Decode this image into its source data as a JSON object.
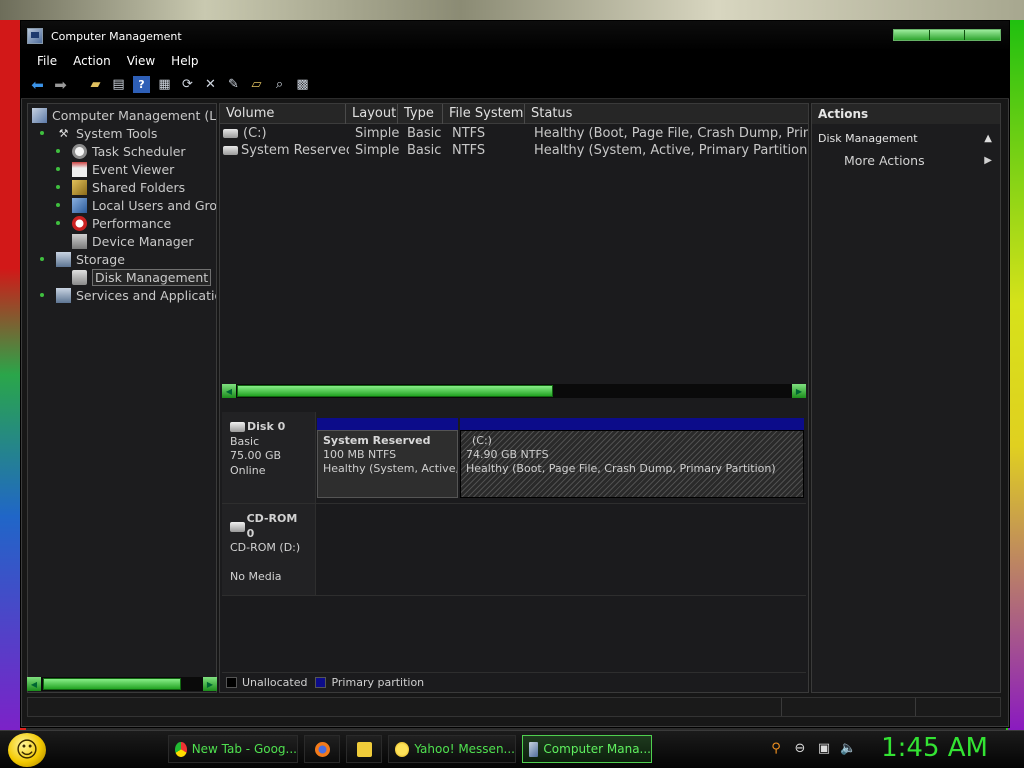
{
  "window": {
    "title": "Computer Management"
  },
  "menu": [
    "File",
    "Action",
    "View",
    "Help"
  ],
  "toolbar": {
    "icons": [
      "back-arrow-icon",
      "forward-arrow-icon",
      "folder-up-icon",
      "show-hide-tree-icon",
      "help-icon",
      "properties-icon",
      "refresh-icon",
      "delete-icon",
      "export-icon",
      "open-icon",
      "find-icon",
      "settings-icon"
    ]
  },
  "tree": {
    "items": [
      {
        "label": "Computer Management (Loc",
        "icon": "computer-icon",
        "level": 0
      },
      {
        "label": "System Tools",
        "icon": "tools-icon",
        "level": 1
      },
      {
        "label": "Task Scheduler",
        "icon": "clock-icon",
        "level": 2
      },
      {
        "label": "Event Viewer",
        "icon": "event-viewer-icon",
        "level": 2
      },
      {
        "label": "Shared Folders",
        "icon": "shared-folder-icon",
        "level": 2
      },
      {
        "label": "Local Users and Grou",
        "icon": "users-icon",
        "level": 2
      },
      {
        "label": "Performance",
        "icon": "performance-icon",
        "level": 2
      },
      {
        "label": "Device Manager",
        "icon": "device-manager-icon",
        "level": 2
      },
      {
        "label": "Storage",
        "icon": "storage-icon",
        "level": 1
      },
      {
        "label": "Disk Management",
        "icon": "disk-icon",
        "level": 2,
        "selected": true
      },
      {
        "label": "Services and Applications",
        "icon": "services-icon",
        "level": 1
      }
    ]
  },
  "volumes": {
    "columns": [
      "Volume",
      "Layout",
      "Type",
      "File System",
      "Status"
    ],
    "rows": [
      {
        "volume": "(C:)",
        "layout": "Simple",
        "type": "Basic",
        "fs": "NTFS",
        "status": "Healthy (Boot, Page File, Crash Dump, Primary"
      },
      {
        "volume": "System Reserved",
        "layout": "Simple",
        "type": "Basic",
        "fs": "NTFS",
        "status": "Healthy (System, Active, Primary Partition)"
      }
    ]
  },
  "disks": [
    {
      "name": "Disk 0",
      "kind": "Basic",
      "size": "75.00 GB",
      "state": "Online",
      "partitions": [
        {
          "name": "System Reserved",
          "size": "100 MB NTFS",
          "status": "Healthy (System, Active, P"
        },
        {
          "name": "(C:)",
          "size": "74.90 GB NTFS",
          "status": "Healthy (Boot, Page File, Crash Dump, Primary Partition)"
        }
      ]
    },
    {
      "name": "CD-ROM 0",
      "kind": "CD-ROM (D:)",
      "state": "No Media"
    }
  ],
  "legend": {
    "unallocated": "Unallocated",
    "primary": "Primary partition"
  },
  "actions": {
    "title": "Actions",
    "section": "Disk Management",
    "more": "More Actions"
  },
  "taskbar": {
    "items": [
      {
        "label": "New Tab - Goog...",
        "icon": "chrome-icon"
      },
      {
        "label": "",
        "icon": "firefox-icon"
      },
      {
        "label": "",
        "icon": "explorer-icon"
      },
      {
        "label": "Yahoo! Messen...",
        "icon": "yahoo-messenger-icon"
      },
      {
        "label": "Computer Mana...",
        "icon": "computer-management-icon",
        "active": true
      }
    ],
    "tray_icons": [
      "search-icon",
      "minus-circle-icon",
      "network-icon",
      "volume-icon"
    ],
    "clock": "1:45 AM"
  },
  "colors": {
    "primary_partition": "#0c0c8a",
    "accent_green": "#33e333",
    "background": "#171717"
  },
  "scroll": {
    "tree_thumb": 0.55,
    "volume_thumb": 0.56
  }
}
